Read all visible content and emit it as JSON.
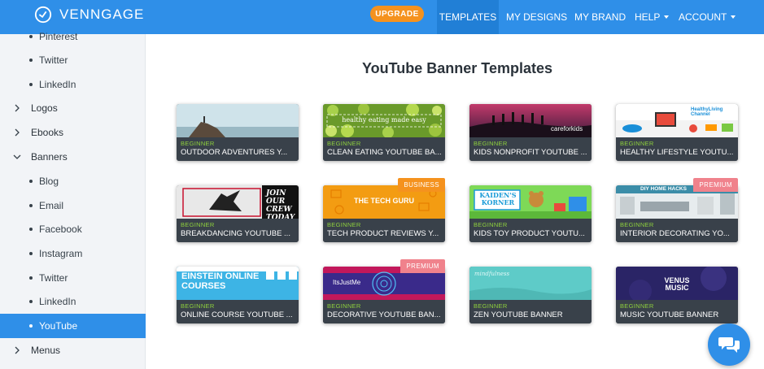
{
  "header": {
    "brand": "VENNGAGE",
    "upgrade_label": "UPGRADE",
    "nav": {
      "templates": "TEMPLATES",
      "my_designs": "MY DESIGNS",
      "my_brand": "MY BRAND",
      "help": "HELP",
      "account": "ACCOUNT"
    }
  },
  "sidebar": {
    "items": [
      {
        "label": "Pinterest",
        "kind": "sub"
      },
      {
        "label": "Twitter",
        "kind": "sub"
      },
      {
        "label": "LinkedIn",
        "kind": "sub"
      },
      {
        "label": "Logos",
        "kind": "category",
        "expanded": false
      },
      {
        "label": "Ebooks",
        "kind": "category",
        "expanded": false
      },
      {
        "label": "Banners",
        "kind": "category",
        "expanded": true
      },
      {
        "label": "Blog",
        "kind": "sub"
      },
      {
        "label": "Email",
        "kind": "sub"
      },
      {
        "label": "Facebook",
        "kind": "sub"
      },
      {
        "label": "Instagram",
        "kind": "sub"
      },
      {
        "label": "Twitter",
        "kind": "sub"
      },
      {
        "label": "LinkedIn",
        "kind": "sub"
      },
      {
        "label": "YouTube",
        "kind": "sub",
        "active": true
      },
      {
        "label": "Menus",
        "kind": "category",
        "expanded": false
      }
    ]
  },
  "main": {
    "title": "YouTube Banner Templates",
    "templates": [
      {
        "level": "BEGINNER",
        "title": "OUTDOOR ADVENTURES Y...",
        "badge": "",
        "thumb_text": ""
      },
      {
        "level": "BEGINNER",
        "title": "CLEAN EATING YOUTUBE BA...",
        "badge": "",
        "thumb_text": "healthy eating made easy"
      },
      {
        "level": "BEGINNER",
        "title": "KIDS NONPROFIT YOUTUBE ...",
        "badge": "",
        "thumb_text": "careforkids"
      },
      {
        "level": "BEGINNER",
        "title": "HEALTHY LIFESTYLE YOUTU...",
        "badge": "",
        "thumb_text": "HealthyLiving Channel"
      },
      {
        "level": "BEGINNER",
        "title": "BREAKDANCING YOUTUBE ...",
        "badge": "",
        "thumb_text": "JOIN OUR CREW TODAY"
      },
      {
        "level": "BEGINNER",
        "title": "TECH PRODUCT REVIEWS Y...",
        "badge": "BUSINESS",
        "thumb_text": "THE TECH GURU"
      },
      {
        "level": "BEGINNER",
        "title": "KIDS TOY PRODUCT YOUTU...",
        "badge": "",
        "thumb_text": "KAIDEN'S KORNER"
      },
      {
        "level": "BEGINNER",
        "title": "INTERIOR DECORATING YO...",
        "badge": "PREMIUM",
        "thumb_text": "DIY HOME HACKS"
      },
      {
        "level": "BEGINNER",
        "title": "ONLINE COURSE YOUTUBE ...",
        "badge": "",
        "thumb_text": "EINSTEIN ONLINE COURSES"
      },
      {
        "level": "BEGINNER",
        "title": "DECORATIVE YOUTUBE BAN...",
        "badge": "PREMIUM",
        "thumb_text": "ItsJustMe"
      },
      {
        "level": "BEGINNER",
        "title": "ZEN YOUTUBE BANNER",
        "badge": "",
        "thumb_text": "mindfulness"
      },
      {
        "level": "BEGINNER",
        "title": "MUSIC YOUTUBE BANNER",
        "badge": "",
        "thumb_text": "VENUS MUSIC"
      }
    ]
  },
  "colors": {
    "brand_blue": "#2f8fe8",
    "upgrade_orange": "#f5921e",
    "beginner_green": "#8fd13d",
    "premium_pink": "#f0828c"
  },
  "icons": {
    "logo": "clock-check-icon",
    "chat": "chat-bubbles-icon",
    "expand": "chevron-right-icon",
    "collapse": "chevron-down-icon"
  }
}
